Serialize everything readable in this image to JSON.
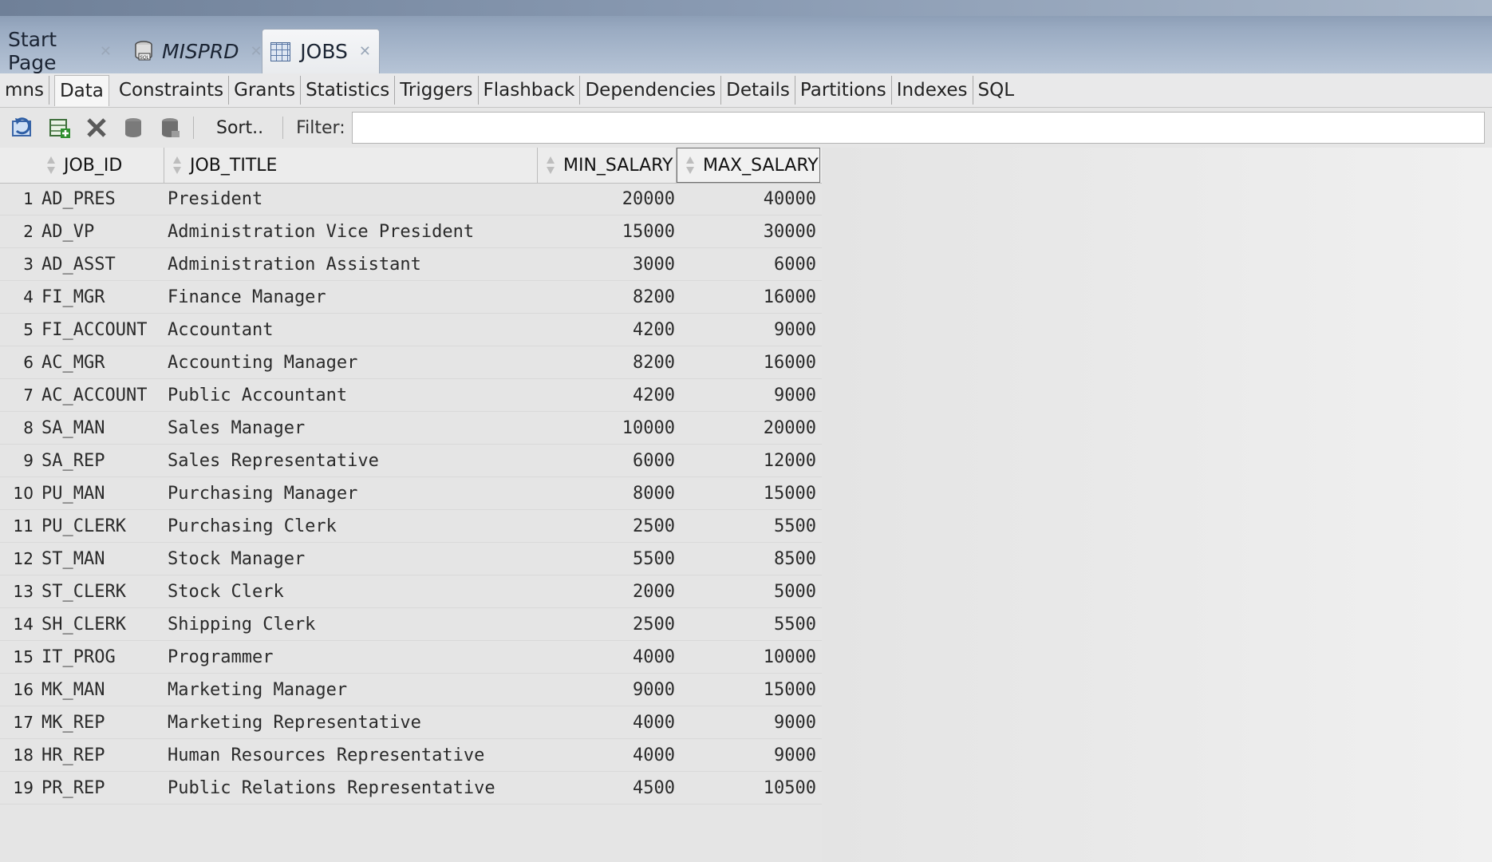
{
  "doc_tabs": [
    {
      "label": "Start Page"
    },
    {
      "label": "MISPRD"
    },
    {
      "label": "JOBS"
    }
  ],
  "subtabs": [
    "mns",
    "Data",
    "Constraints",
    "Grants",
    "Statistics",
    "Triggers",
    "Flashback",
    "Dependencies",
    "Details",
    "Partitions",
    "Indexes",
    "SQL"
  ],
  "toolbar": {
    "sort_label": "Sort..",
    "filter_label": "Filter:",
    "filter_value": ""
  },
  "grid": {
    "columns": [
      "JOB_ID",
      "JOB_TITLE",
      "MIN_SALARY",
      "MAX_SALARY"
    ],
    "rows": [
      [
        "1",
        "AD_PRES",
        "President",
        "20000",
        "40000"
      ],
      [
        "2",
        "AD_VP",
        "Administration Vice President",
        "15000",
        "30000"
      ],
      [
        "3",
        "AD_ASST",
        "Administration Assistant",
        "3000",
        "6000"
      ],
      [
        "4",
        "FI_MGR",
        "Finance Manager",
        "8200",
        "16000"
      ],
      [
        "5",
        "FI_ACCOUNT",
        "Accountant",
        "4200",
        "9000"
      ],
      [
        "6",
        "AC_MGR",
        "Accounting Manager",
        "8200",
        "16000"
      ],
      [
        "7",
        "AC_ACCOUNT",
        "Public Accountant",
        "4200",
        "9000"
      ],
      [
        "8",
        "SA_MAN",
        "Sales Manager",
        "10000",
        "20000"
      ],
      [
        "9",
        "SA_REP",
        "Sales Representative",
        "6000",
        "12000"
      ],
      [
        "10",
        "PU_MAN",
        "Purchasing Manager",
        "8000",
        "15000"
      ],
      [
        "11",
        "PU_CLERK",
        "Purchasing Clerk",
        "2500",
        "5500"
      ],
      [
        "12",
        "ST_MAN",
        "Stock Manager",
        "5500",
        "8500"
      ],
      [
        "13",
        "ST_CLERK",
        "Stock Clerk",
        "2000",
        "5000"
      ],
      [
        "14",
        "SH_CLERK",
        "Shipping Clerk",
        "2500",
        "5500"
      ],
      [
        "15",
        "IT_PROG",
        "Programmer",
        "4000",
        "10000"
      ],
      [
        "16",
        "MK_MAN",
        "Marketing Manager",
        "9000",
        "15000"
      ],
      [
        "17",
        "MK_REP",
        "Marketing Representative",
        "4000",
        "9000"
      ],
      [
        "18",
        "HR_REP",
        "Human Resources Representative",
        "4000",
        "9000"
      ],
      [
        "19",
        "PR_REP",
        "Public Relations Representative",
        "4500",
        "10500"
      ]
    ]
  },
  "colors": {
    "header_blue": "#8a9bb3",
    "grid_bg": "#e5e5e5"
  }
}
